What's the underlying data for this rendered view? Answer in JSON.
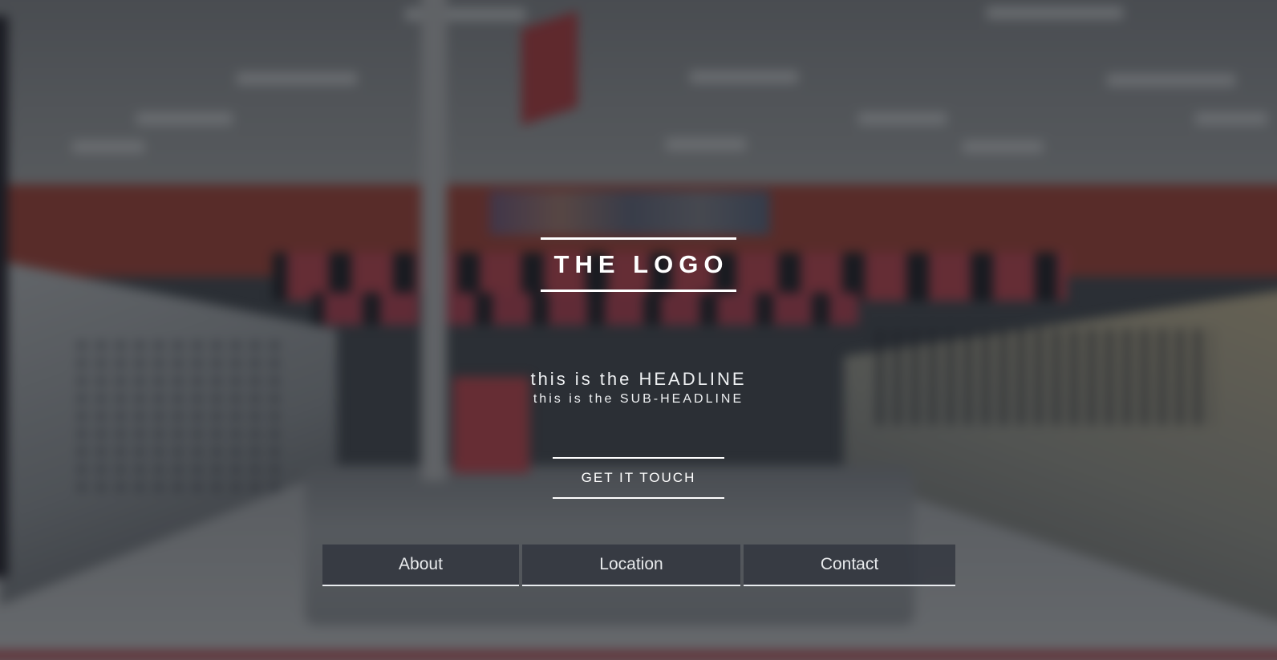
{
  "hero": {
    "logo": "THE LOGO",
    "headline": "this is the HEADLINE",
    "subheadline": "this is the SUB-HEADLINE",
    "cta_label": "GET IT TOUCH"
  },
  "nav": {
    "items": [
      {
        "label": "About"
      },
      {
        "label": "Location"
      },
      {
        "label": "Contact"
      }
    ]
  },
  "colors": {
    "overlay": "#1e2228",
    "text": "#ffffff",
    "nav_bg": "#2c313a"
  },
  "background": {
    "icon": "store-interior-photo"
  }
}
